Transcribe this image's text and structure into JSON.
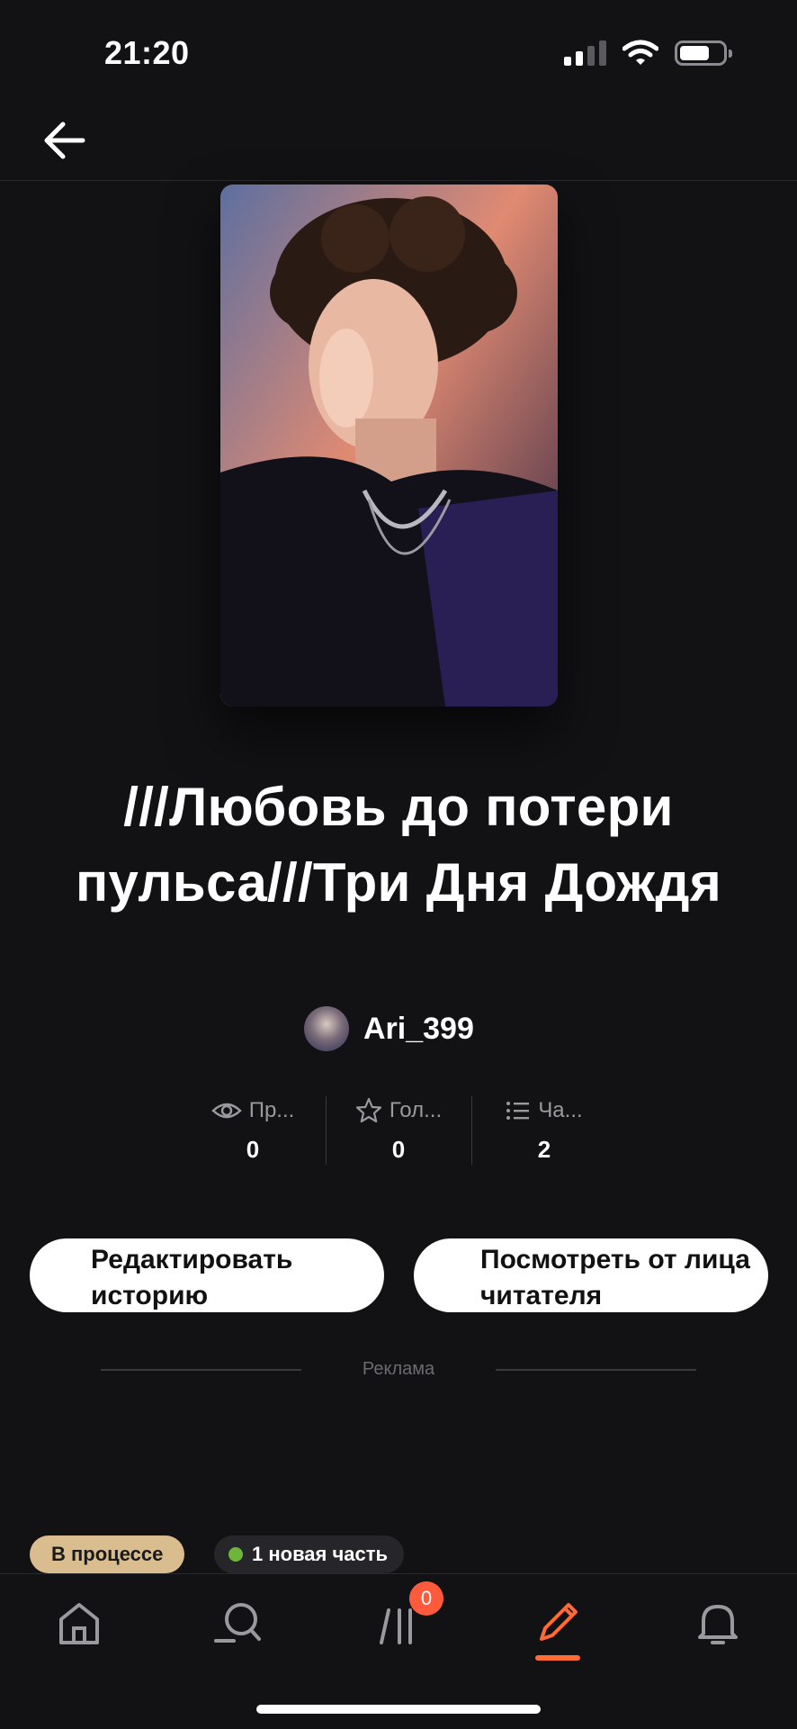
{
  "status_bar": {
    "time": "21:20"
  },
  "story": {
    "title": "///Любовь до потери пульса///Три Дня Дождя",
    "author": "Ari_399",
    "stats": [
      {
        "icon": "eye-icon",
        "label": "Пр...",
        "value": "0"
      },
      {
        "icon": "star-icon",
        "label": "Гол...",
        "value": "0"
      },
      {
        "icon": "list-icon",
        "label": "Ча...",
        "value": "2"
      }
    ]
  },
  "actions": {
    "edit_label": "Редактировать историю",
    "reader_view_label": "Посмотреть от лица читателя"
  },
  "ad": {
    "label": "Реклама"
  },
  "badges": {
    "status": "В процессе",
    "new_parts": "1 новая часть"
  },
  "bottom_nav": {
    "library_count": "0",
    "active": "write",
    "colors": {
      "accent": "#ff6a35",
      "badge": "#ff5a3c"
    }
  }
}
